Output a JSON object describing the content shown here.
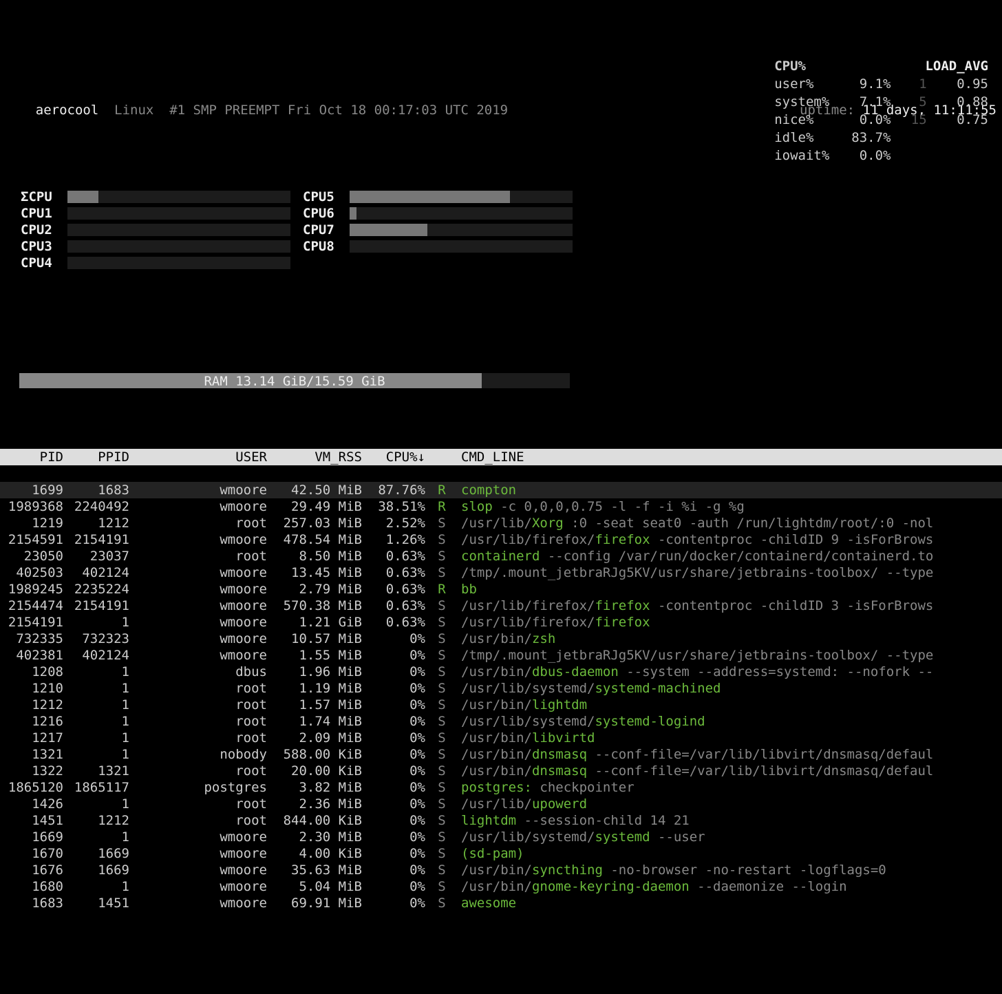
{
  "header": {
    "hostname": "aerocool",
    "kernel": "Linux  #1 SMP PREEMPT Fri Oct 18 00:17:03 UTC 2019",
    "uptime_label": "uptime:",
    "uptime": "11 days, 11:11:55"
  },
  "cpu_bars": {
    "left": [
      {
        "label": "ΣCPU",
        "pct": 14
      },
      {
        "label": "CPU1",
        "pct": 0
      },
      {
        "label": "CPU2",
        "pct": 0
      },
      {
        "label": "CPU3",
        "pct": 0
      },
      {
        "label": "CPU4",
        "pct": 0
      }
    ],
    "right": [
      {
        "label": "CPU5",
        "pct": 72
      },
      {
        "label": "CPU6",
        "pct": 3
      },
      {
        "label": "CPU7",
        "pct": 35
      },
      {
        "label": "CPU8",
        "pct": 0
      }
    ]
  },
  "stats": {
    "cpu_header": "CPU%",
    "load_header": "LOAD_AVG",
    "rows": [
      {
        "label": "user%",
        "val": "9.1%",
        "ln": "1",
        "lv": "0.95"
      },
      {
        "label": "system%",
        "val": "7.1%",
        "ln": "5",
        "lv": "0.88"
      },
      {
        "label": "nice%",
        "val": "0.0%",
        "ln": "15",
        "lv": "0.75"
      },
      {
        "label": "idle%",
        "val": "83.7%",
        "ln": "",
        "lv": ""
      },
      {
        "label": "iowait%",
        "val": "0.0%",
        "ln": "",
        "lv": ""
      }
    ]
  },
  "ram": {
    "label": "RAM",
    "used": "13.14 GiB",
    "total": "15.59 GiB",
    "pct": 84
  },
  "table": {
    "headers": {
      "pid": "PID",
      "ppid": "PPID",
      "user": "USER",
      "rss": "VM_RSS",
      "cpu": "CPU%↓",
      "cmd": "CMD_LINE"
    },
    "rows": [
      {
        "sel": true,
        "pid": "1699",
        "ppid": "1683",
        "user": "wmoore",
        "rss": "42.50 MiB",
        "cpu": "87.76%",
        "st": "R",
        "st_green": true,
        "cmd": [
          {
            "t": "compton",
            "g": true
          }
        ]
      },
      {
        "pid": "1989368",
        "ppid": "2240492",
        "user": "wmoore",
        "rss": "29.49 MiB",
        "cpu": "38.51%",
        "st": "R",
        "st_green": true,
        "cmd": [
          {
            "t": "slop",
            "g": true
          },
          {
            "t": " -c 0,0,0,0.75 -l -f -i %i -g %g"
          }
        ]
      },
      {
        "pid": "1219",
        "ppid": "1212",
        "user": "root",
        "rss": "257.03 MiB",
        "cpu": "2.52%",
        "st": "S",
        "cmd": [
          {
            "t": "/usr/lib/"
          },
          {
            "t": "Xorg",
            "g": true
          },
          {
            "t": " :0 -seat seat0 -auth /run/lightdm/root/:0 -nol"
          }
        ]
      },
      {
        "pid": "2154591",
        "ppid": "2154191",
        "user": "wmoore",
        "rss": "478.54 MiB",
        "cpu": "1.26%",
        "st": "S",
        "cmd": [
          {
            "t": "/usr/lib/firefox/"
          },
          {
            "t": "firefox",
            "g": true
          },
          {
            "t": " -contentproc -childID 9 -isForBrows"
          }
        ]
      },
      {
        "pid": "23050",
        "ppid": "23037",
        "user": "root",
        "rss": "8.50 MiB",
        "cpu": "0.63%",
        "st": "S",
        "cmd": [
          {
            "t": "containerd",
            "g": true
          },
          {
            "t": " --config /var/run/docker/containerd/containerd.to"
          }
        ]
      },
      {
        "pid": "402503",
        "ppid": "402124",
        "user": "wmoore",
        "rss": "13.45 MiB",
        "cpu": "0.63%",
        "st": "S",
        "cmd": [
          {
            "t": "/tmp/.mount_jetbraRJg5KV/usr/share/jetbrains-toolbox/"
          },
          {
            "t": " --type"
          }
        ]
      },
      {
        "pid": "1989245",
        "ppid": "2235224",
        "user": "wmoore",
        "rss": "2.79 MiB",
        "cpu": "0.63%",
        "st": "R",
        "st_green": true,
        "cmd": [
          {
            "t": "bb",
            "g": true
          }
        ]
      },
      {
        "pid": "2154474",
        "ppid": "2154191",
        "user": "wmoore",
        "rss": "570.38 MiB",
        "cpu": "0.63%",
        "st": "S",
        "cmd": [
          {
            "t": "/usr/lib/firefox/"
          },
          {
            "t": "firefox",
            "g": true
          },
          {
            "t": " -contentproc -childID 3 -isForBrows"
          }
        ]
      },
      {
        "pid": "2154191",
        "ppid": "1",
        "user": "wmoore",
        "rss": "1.21 GiB",
        "cpu": "0.63%",
        "st": "S",
        "cmd": [
          {
            "t": "/usr/lib/firefox/"
          },
          {
            "t": "firefox",
            "g": true
          }
        ]
      },
      {
        "pid": "732335",
        "ppid": "732323",
        "user": "wmoore",
        "rss": "10.57 MiB",
        "cpu": "0%",
        "st": "S",
        "cmd": [
          {
            "t": "/usr/bin/"
          },
          {
            "t": "zsh",
            "g": true
          }
        ]
      },
      {
        "pid": "402381",
        "ppid": "402124",
        "user": "wmoore",
        "rss": "1.55 MiB",
        "cpu": "0%",
        "st": "S",
        "cmd": [
          {
            "t": "/tmp/.mount_jetbraRJg5KV/usr/share/jetbrains-toolbox/"
          },
          {
            "t": " --type"
          }
        ]
      },
      {
        "pid": "1208",
        "ppid": "1",
        "user": "dbus",
        "rss": "1.96 MiB",
        "cpu": "0%",
        "st": "S",
        "cmd": [
          {
            "t": "/usr/bin/"
          },
          {
            "t": "dbus-daemon",
            "g": true
          },
          {
            "t": " --system --address=systemd: --nofork --"
          }
        ]
      },
      {
        "pid": "1210",
        "ppid": "1",
        "user": "root",
        "rss": "1.19 MiB",
        "cpu": "0%",
        "st": "S",
        "cmd": [
          {
            "t": "/usr/lib/systemd/"
          },
          {
            "t": "systemd-machined",
            "g": true
          }
        ]
      },
      {
        "pid": "1212",
        "ppid": "1",
        "user": "root",
        "rss": "1.57 MiB",
        "cpu": "0%",
        "st": "S",
        "cmd": [
          {
            "t": "/usr/bin/"
          },
          {
            "t": "lightdm",
            "g": true
          }
        ]
      },
      {
        "pid": "1216",
        "ppid": "1",
        "user": "root",
        "rss": "1.74 MiB",
        "cpu": "0%",
        "st": "S",
        "cmd": [
          {
            "t": "/usr/lib/systemd/"
          },
          {
            "t": "systemd-logind",
            "g": true
          }
        ]
      },
      {
        "pid": "1217",
        "ppid": "1",
        "user": "root",
        "rss": "2.09 MiB",
        "cpu": "0%",
        "st": "S",
        "cmd": [
          {
            "t": "/usr/bin/"
          },
          {
            "t": "libvirtd",
            "g": true
          }
        ]
      },
      {
        "pid": "1321",
        "ppid": "1",
        "user": "nobody",
        "rss": "588.00 KiB",
        "cpu": "0%",
        "st": "S",
        "cmd": [
          {
            "t": "/usr/bin/"
          },
          {
            "t": "dnsmasq",
            "g": true
          },
          {
            "t": " --conf-file=/var/lib/libvirt/dnsmasq/defaul"
          }
        ]
      },
      {
        "pid": "1322",
        "ppid": "1321",
        "user": "root",
        "rss": "20.00 KiB",
        "cpu": "0%",
        "st": "S",
        "cmd": [
          {
            "t": "/usr/bin/"
          },
          {
            "t": "dnsmasq",
            "g": true
          },
          {
            "t": " --conf-file=/var/lib/libvirt/dnsmasq/defaul"
          }
        ]
      },
      {
        "pid": "1865120",
        "ppid": "1865117",
        "user": "postgres",
        "rss": "3.82 MiB",
        "cpu": "0%",
        "st": "S",
        "cmd": [
          {
            "t": "postgres:",
            "g": true
          },
          {
            "t": " checkpointer"
          }
        ]
      },
      {
        "pid": "1426",
        "ppid": "1",
        "user": "root",
        "rss": "2.36 MiB",
        "cpu": "0%",
        "st": "S",
        "cmd": [
          {
            "t": "/usr/lib/"
          },
          {
            "t": "upowerd",
            "g": true
          }
        ]
      },
      {
        "pid": "1451",
        "ppid": "1212",
        "user": "root",
        "rss": "844.00 KiB",
        "cpu": "0%",
        "st": "S",
        "cmd": [
          {
            "t": "lightdm",
            "g": true
          },
          {
            "t": " --session-child 14 21"
          }
        ]
      },
      {
        "pid": "1669",
        "ppid": "1",
        "user": "wmoore",
        "rss": "2.30 MiB",
        "cpu": "0%",
        "st": "S",
        "cmd": [
          {
            "t": "/usr/lib/systemd/"
          },
          {
            "t": "systemd",
            "g": true
          },
          {
            "t": " --user"
          }
        ]
      },
      {
        "pid": "1670",
        "ppid": "1669",
        "user": "wmoore",
        "rss": "4.00 KiB",
        "cpu": "0%",
        "st": "S",
        "cmd": [
          {
            "t": "(sd-pam)",
            "g": true
          }
        ]
      },
      {
        "pid": "1676",
        "ppid": "1669",
        "user": "wmoore",
        "rss": "35.63 MiB",
        "cpu": "0%",
        "st": "S",
        "cmd": [
          {
            "t": "/usr/bin/"
          },
          {
            "t": "syncthing",
            "g": true
          },
          {
            "t": " -no-browser -no-restart -logflags=0"
          }
        ]
      },
      {
        "pid": "1680",
        "ppid": "1",
        "user": "wmoore",
        "rss": "5.04 MiB",
        "cpu": "0%",
        "st": "S",
        "cmd": [
          {
            "t": "/usr/bin/"
          },
          {
            "t": "gnome-keyring-daemon",
            "g": true
          },
          {
            "t": " --daemonize --login"
          }
        ]
      },
      {
        "pid": "1683",
        "ppid": "1451",
        "user": "wmoore",
        "rss": "69.91 MiB",
        "cpu": "0%",
        "st": "S",
        "cmd": [
          {
            "t": "awesome",
            "g": true
          }
        ]
      }
    ]
  }
}
